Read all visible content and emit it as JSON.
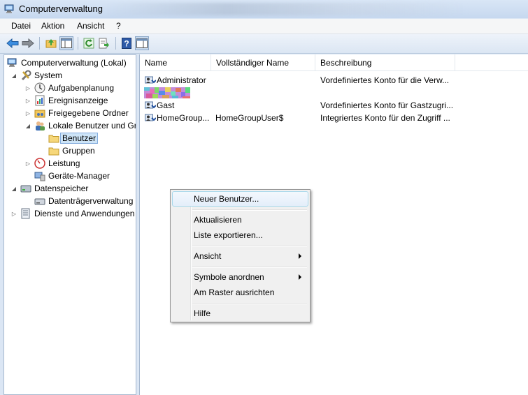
{
  "window": {
    "title": "Computerverwaltung"
  },
  "menubar": {
    "items": [
      "Datei",
      "Aktion",
      "Ansicht",
      "?"
    ]
  },
  "toolbar": {
    "buttons": [
      "back-arrow-icon",
      "forward-arrow-icon",
      "up-folder-icon",
      "show-hide-tree-icon",
      "refresh-icon",
      "export-list-icon",
      "help-icon",
      "show-hide-action-pane-icon"
    ]
  },
  "tree": {
    "items": [
      {
        "label": "Computerverwaltung (Lokal)",
        "icon": "computer-management-icon"
      },
      {
        "label": "System",
        "icon": "system-tools-icon",
        "expanded": true
      },
      {
        "label": "Aufgabenplanung",
        "icon": "clock-icon"
      },
      {
        "label": "Ereignisanzeige",
        "icon": "event-viewer-icon"
      },
      {
        "label": "Freigegebene Ordner",
        "icon": "shared-folder-icon"
      },
      {
        "label": "Lokale Benutzer und Gr",
        "icon": "users-groups-icon",
        "expanded": true
      },
      {
        "label": "Benutzer",
        "icon": "folder-icon",
        "selected": true
      },
      {
        "label": "Gruppen",
        "icon": "folder-icon"
      },
      {
        "label": "Leistung",
        "icon": "performance-icon"
      },
      {
        "label": "Geräte-Manager",
        "icon": "device-manager-icon"
      },
      {
        "label": "Datenspeicher",
        "icon": "storage-icon",
        "expanded": true
      },
      {
        "label": "Datenträgerverwaltung",
        "icon": "disk-management-icon"
      },
      {
        "label": "Dienste und Anwendungen",
        "icon": "services-icon"
      }
    ]
  },
  "list": {
    "columns": [
      "Name",
      "Vollständiger Name",
      "Beschreibung"
    ],
    "rows": [
      {
        "name": "Administrator",
        "full_name": "",
        "description": "Vordefiniertes Konto für die Verw..."
      },
      {
        "name": "",
        "full_name": "",
        "description": ""
      },
      {
        "name": "Gast",
        "full_name": "",
        "description": "Vordefiniertes Konto für Gastzugri..."
      },
      {
        "name": "HomeGroup...",
        "full_name": "HomeGroupUser$",
        "description": "Integriertes Konto für den Zugriff ..."
      }
    ]
  },
  "context_menu": {
    "items": [
      {
        "label": "Neuer Benutzer...",
        "highlighted": true
      },
      {
        "label": "Aktualisieren"
      },
      {
        "label": "Liste exportieren..."
      },
      {
        "label": "Ansicht",
        "submenu": true
      },
      {
        "label": "Symbole anordnen",
        "submenu": true
      },
      {
        "label": "Am Raster ausrichten"
      },
      {
        "label": "Hilfe"
      }
    ]
  }
}
